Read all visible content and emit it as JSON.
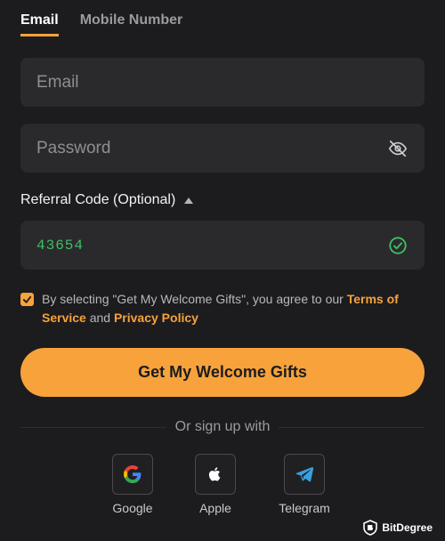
{
  "tabs": [
    {
      "label": "Email",
      "active": true
    },
    {
      "label": "Mobile Number",
      "active": false
    }
  ],
  "email": {
    "placeholder": "Email",
    "value": ""
  },
  "password": {
    "placeholder": "Password",
    "value": "",
    "visibility_icon": "eye-slash-icon"
  },
  "referral": {
    "label": "Referral Code (Optional)",
    "value": "43654",
    "valid": true,
    "status_icon": "check-circle-icon"
  },
  "agreement": {
    "checked": true,
    "prefix": "By selecting \"Get My Welcome Gifts\", you agree to our ",
    "terms_link": "Terms of Service",
    "conjunction": " and ",
    "privacy_link": "Privacy Policy"
  },
  "cta_label": "Get My Welcome Gifts",
  "or_text": "Or sign up with",
  "socials": [
    {
      "label": "Google",
      "icon": "google-icon"
    },
    {
      "label": "Apple",
      "icon": "apple-icon"
    },
    {
      "label": "Telegram",
      "icon": "telegram-icon"
    }
  ],
  "watermark": "BitDegree",
  "colors": {
    "accent": "#f7a23b",
    "background": "#1c1c1e",
    "field": "#2a2a2d",
    "success": "#3fbf64"
  }
}
